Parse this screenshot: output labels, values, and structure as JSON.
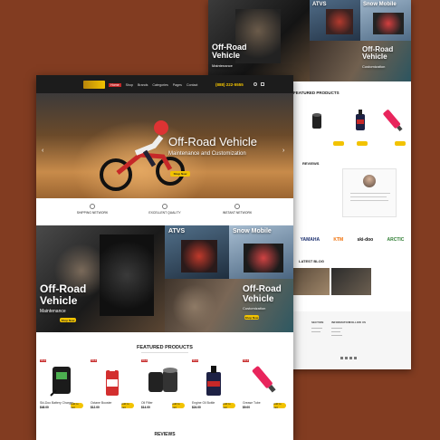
{
  "colors": {
    "background": "#823c21",
    "accent_yellow": "#f2c300",
    "header_dark": "#1c1c1c",
    "sale_red": "#c62828"
  },
  "header": {
    "phone": "(888) 222-5555",
    "nav": [
      "Home",
      "Shop",
      "Brands",
      "Categories",
      "Pages",
      "Contact"
    ]
  },
  "hero": {
    "title": "Off-Road Vehicle",
    "subtitle": "Maintenance and Customization",
    "button": "Shop Now"
  },
  "features": [
    {
      "icon": "truck-icon",
      "title": "SHIPPING NETWORK"
    },
    {
      "icon": "return-icon",
      "title": "EXCELLENT QUALITY"
    },
    {
      "icon": "car-icon",
      "title": "INSTANT NETWORK"
    }
  ],
  "categories": {
    "offroad_left": {
      "title": "Off-Road Vehicle",
      "sub": "Maintenance",
      "button": "Shop Now"
    },
    "atvs": {
      "title": "ATVS"
    },
    "snowmobile": {
      "title": "Snow Mobile"
    },
    "offroad_right": {
      "title": "Off-Road Vehicle",
      "sub": "Customization",
      "button": "Shop Now"
    }
  },
  "featured": {
    "title": "FEATURED PRODUCTS",
    "products": [
      {
        "name": "Ski-Doo Battery Charger",
        "price": "$48.00",
        "sale": "SALE",
        "cart": "Add to cart",
        "icon": "charger-icon"
      },
      {
        "name": "Octane Booster",
        "price": "$12.00",
        "sale": "SALE",
        "cart": "Add to cart",
        "icon": "bottle-icon"
      },
      {
        "name": "Oil Filter",
        "price": "$14.00",
        "sale": "SALE",
        "cart": "Add to cart",
        "icon": "filter-icon"
      },
      {
        "name": "Engine Oil Bottle",
        "price": "$24.00",
        "sale": "SALE",
        "cart": "Add to cart",
        "icon": "oil-icon"
      },
      {
        "name": "Grease Tube",
        "price": "$9.00",
        "sale": "SALE",
        "cart": "Add to cart",
        "icon": "tube-icon"
      }
    ]
  },
  "reviews": {
    "title": "REVIEWS"
  },
  "back_page": {
    "tile_atvs": "ATVS",
    "tile_snow": "Snow Mobile",
    "tile_offroad_left": "Off-Road Vehicle",
    "tile_offroad_left_sub": "Maintenance",
    "tile_offroad_right": "Off-Road Vehicle",
    "tile_offroad_right_sub": "Customization",
    "featured_title": "FEATURED PRODUCTS",
    "reviews_title": "REVIEWS",
    "brands": [
      "YAMAHA",
      "KTM",
      "ski-doo",
      "ARCTIC"
    ],
    "latest_blog_title": "LATEST BLOG",
    "footer_cols": [
      "SECTION",
      "INFORMATION",
      "FOLLOW US"
    ]
  }
}
